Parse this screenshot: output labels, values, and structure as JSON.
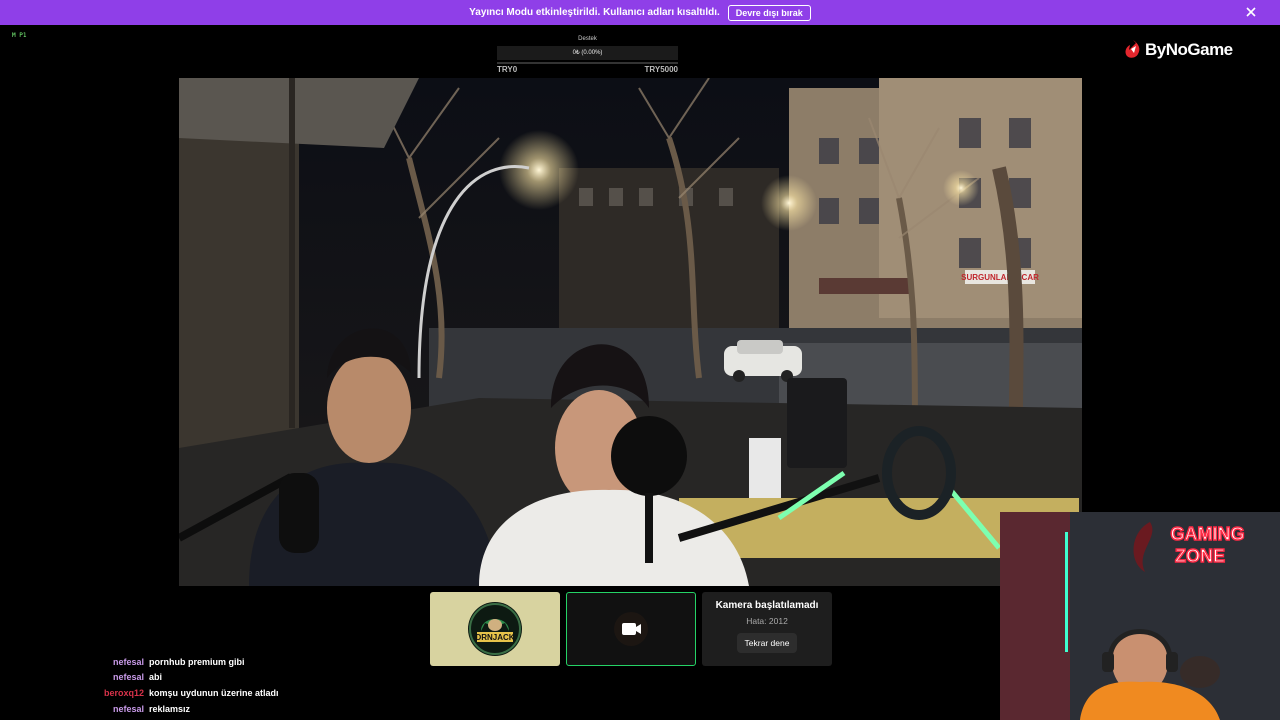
{
  "banner": {
    "message": "Yayıncı Modu etkinleştirildi. Kullanıcı adları kısaltıldı.",
    "disable_button": "Devre dışı bırak",
    "close_icon": "close-icon"
  },
  "live_indicator": {
    "label": "M P1"
  },
  "donation": {
    "title": "Destek",
    "progress_text": "0₺ (0.00%)",
    "progress_fraction": 0.0,
    "min_label": "TRY0",
    "max_label": "TRY5000"
  },
  "logo": {
    "text": "ByNoGame"
  },
  "main_video": {
    "shop_sign": "SURGUNLAR TİCAR",
    "colors": {
      "sky": "#0e1018",
      "street": "#2d2f33",
      "car": "#e6e6e2"
    }
  },
  "tiles": [
    {
      "type": "avatar",
      "avatar_text": "DRNJACK"
    },
    {
      "type": "camera",
      "icon": "video-camera-icon"
    },
    {
      "type": "error",
      "title": "Kamera başlatılamadı",
      "code": "Hata: 2012",
      "retry": "Tekrar dene"
    }
  ],
  "chat": [
    {
      "user": "nefesal",
      "message": "pornhub premium gibi",
      "color": "#c89ae8"
    },
    {
      "user": "nefesal",
      "message": "abi",
      "color": "#c89ae8"
    },
    {
      "user": "beroxq12",
      "message": "komşu uydunun üzerine atladı",
      "color": "#d8324a"
    },
    {
      "user": "nefesal",
      "message": "reklamsız",
      "color": "#c89ae8"
    }
  ],
  "webcam": {
    "neon_sign": "GAMING ZONE"
  },
  "colors": {
    "accent": "#8f3fe8",
    "active_border": "#25d366",
    "background": "#000000"
  }
}
